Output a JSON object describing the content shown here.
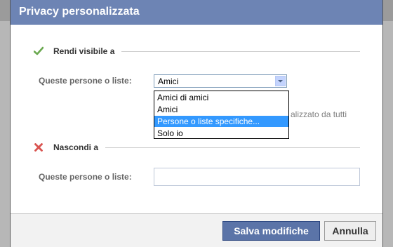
{
  "dialog": {
    "title": "Privacy personalizzata"
  },
  "visible_section": {
    "heading": "Rendi visibile a",
    "icon": "check-icon",
    "field_label": "Queste persone o liste:",
    "select_value": "Amici",
    "options": [
      "Amici di amici",
      "Amici",
      "Persone o liste specifiche...",
      "Solo io"
    ],
    "selected_option_index": 2,
    "hint_text": "alizzato da tutti"
  },
  "hide_section": {
    "heading": "Nascondi a",
    "icon": "cross-icon",
    "field_label": "Queste persone o liste:",
    "input_value": ""
  },
  "footer": {
    "save_label": "Salva modifiche",
    "cancel_label": "Annulla"
  },
  "colors": {
    "title_bar": "#6d84b4",
    "primary_button": "#5b74a8",
    "highlight": "#3399ff"
  }
}
